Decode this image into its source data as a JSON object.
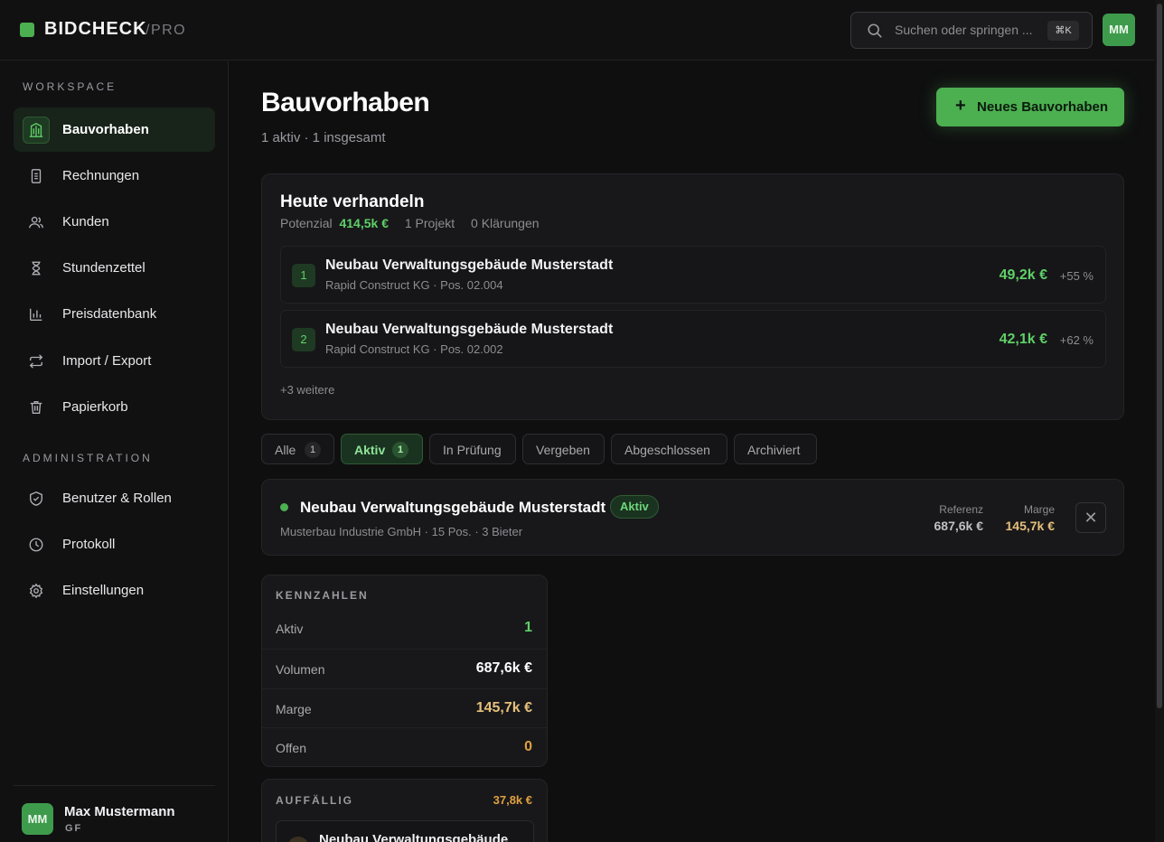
{
  "app": {
    "name": "BIDCHECK",
    "tier": "/PRO"
  },
  "search": {
    "placeholder": "Suchen oder springen ...",
    "shortcut": "⌘K"
  },
  "top_user_initials": "MM",
  "sidebar": {
    "sections": [
      {
        "label": "WORKSPACE"
      },
      {
        "label": "ADMINISTRATION"
      }
    ],
    "items": [
      {
        "label": "Bauvorhaben",
        "icon": "building-icon",
        "active": true
      },
      {
        "label": "Rechnungen",
        "icon": "receipt-icon"
      },
      {
        "label": "Kunden",
        "icon": "users-icon"
      },
      {
        "label": "Stundenzettel",
        "icon": "hourglass-icon"
      },
      {
        "label": "Preisdatenbank",
        "icon": "bar-chart-icon"
      },
      {
        "label": "Import / Export",
        "icon": "repeat-icon"
      },
      {
        "label": "Papierkorb",
        "icon": "trash-icon"
      },
      {
        "label": "Benutzer & Rollen",
        "icon": "shield-icon"
      },
      {
        "label": "Protokoll",
        "icon": "clock-icon"
      },
      {
        "label": "Einstellungen",
        "icon": "gear-icon"
      }
    ],
    "user": {
      "initials": "MM",
      "name": "Max Mustermann",
      "role": "GF"
    }
  },
  "page": {
    "title": "Bauvorhaben",
    "subtitle": "1 aktiv · 1 insgesamt",
    "new_button": "Neues Bauvorhaben"
  },
  "today": {
    "title": "Heute verhandeln",
    "potential_label": "Potenzial",
    "potential_value": "414,5k €",
    "projects": "1 Projekt",
    "clarifications": "0 Klärungen",
    "deals": [
      {
        "rank": "1",
        "title": "Neubau Verwaltungsgebäude Musterstadt",
        "sub": "Rapid Construct KG · Pos. 02.004",
        "amount": "49,2k €",
        "pct": "+55 %"
      },
      {
        "rank": "2",
        "title": "Neubau Verwaltungsgebäude Musterstadt",
        "sub": "Rapid Construct KG · Pos. 02.002",
        "amount": "42,1k €",
        "pct": "+62 %"
      }
    ],
    "more": "+3 weitere"
  },
  "filters": [
    {
      "label": "Alle",
      "count": "1"
    },
    {
      "label": "Aktiv",
      "count": "1",
      "active": true
    },
    {
      "label": "In Prüfung"
    },
    {
      "label": "Vergeben"
    },
    {
      "label": "Abgeschlossen"
    },
    {
      "label": "Archiviert"
    }
  ],
  "project": {
    "title": "Neubau Verwaltungsgebäude Musterstadt",
    "status": "Aktiv",
    "sub": "Musterbau Industrie GmbH · 15 Pos. · 3 Bieter",
    "reference_label": "Referenz",
    "reference_value": "687,6k €",
    "margin_label": "Marge",
    "margin_value": "145,7k €",
    "close": "✕"
  },
  "kpis": {
    "title": "KENNZAHLEN",
    "rows": [
      {
        "label": "Aktiv",
        "value": "1"
      },
      {
        "label": "Volumen",
        "value": "687,6k €"
      },
      {
        "label": "Marge",
        "value": "145,7k €"
      },
      {
        "label": "Offen",
        "value": "0"
      }
    ]
  },
  "notable": {
    "title": "AUFFÄLLIG",
    "amount": "37,8k €",
    "item_title": "Neubau Verwaltungsgebäude"
  },
  "colors": {
    "accent": "#4caf50",
    "accent_text": "#5fd068",
    "gold": "#e5c07b",
    "orange": "#e0a040"
  }
}
